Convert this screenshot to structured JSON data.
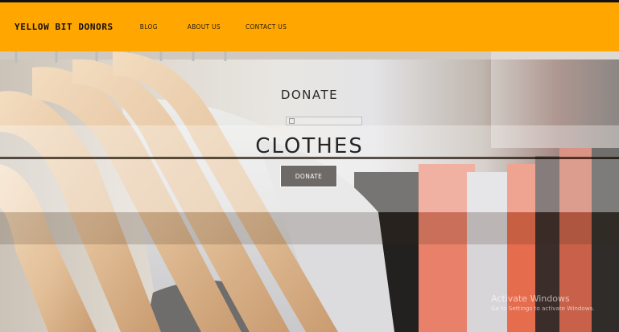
{
  "navbar": {
    "brand": "YELLOW BIT DONORS",
    "links": [
      {
        "label": "BLOG"
      },
      {
        "label": "ABOUT US"
      },
      {
        "label": "CONTACT US"
      }
    ],
    "background": "#ffa600"
  },
  "hero": {
    "small_heading": "DONATE",
    "broken_image_alt": "",
    "big_heading": "CLOTHES",
    "button_label": "DONATE",
    "background_image": "clothes-on-hangers-photo"
  },
  "watermark": {
    "title": "Activate Windows",
    "subtitle": "Go to Settings to activate Windows."
  }
}
